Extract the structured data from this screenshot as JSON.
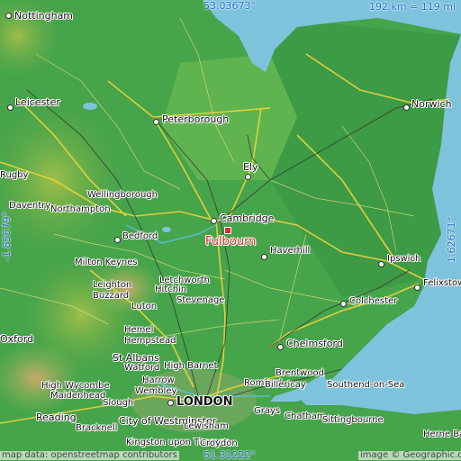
{
  "map": {
    "highlight": {
      "name": "Fulbourn",
      "color": "#e8262b"
    },
    "coordinates": {
      "top": "53.03673°",
      "bottom": "51.31222°",
      "left": "-1.85579°",
      "right": "1.62671°"
    },
    "scale": "192 km = 119 mi",
    "attribution_left": "map data: openstreetmap contributors",
    "attribution_right": "image © Geographic.org",
    "places": {
      "nottingham": "Nottingham",
      "leicester": "Leicester",
      "peterborough": "Peterborough",
      "norwich": "Norwich",
      "ely": "Ely",
      "cambridge": "Cambridge",
      "wellingborough": "Wellingborough",
      "daventry": "Daventry",
      "northampton": "Northampton",
      "rugby": "Rugby",
      "bedford": "Bedford",
      "haverhill": "Haverhill",
      "ipswich": "Ipswich",
      "felixstowe": "Felixstowe",
      "milton_keynes": "Milton Keynes",
      "letchworth": "Letchworth",
      "leighton": "Leighton",
      "buzzard": "Buzzard",
      "hitchin": "Hitchin",
      "stevenage": "Stevenage",
      "colchester": "Colchester",
      "luton": "Luton",
      "oxford": "Oxford",
      "hemel": "Hemel",
      "hempstead": "Hempstead",
      "chelmsford": "Chelmsford",
      "st_albans": "St Albans",
      "high_barnet": "High Barnet",
      "watford": "Watford",
      "brentwood": "Brentwood",
      "harrow": "Harrow",
      "high_wycombe": "High Wycombe",
      "maidenhead": "Maidenhead",
      "wembley": "Wembley",
      "romford": "Romford",
      "billericay": "Billericay",
      "southend": "Southend-on-Sea",
      "london": "LONDON",
      "reading": "Reading",
      "slough": "Slough",
      "bracknell": "Bracknell",
      "city_of_westminster": "City of Westminster",
      "grays": "Grays",
      "lewisham": "Lewisham",
      "kingston": "Kingston upon Thames",
      "croydon": "Croydon",
      "chatham": "Chatham",
      "sittingbourne": "Sittingbourne",
      "herne_bay": "Herne Bay"
    }
  }
}
